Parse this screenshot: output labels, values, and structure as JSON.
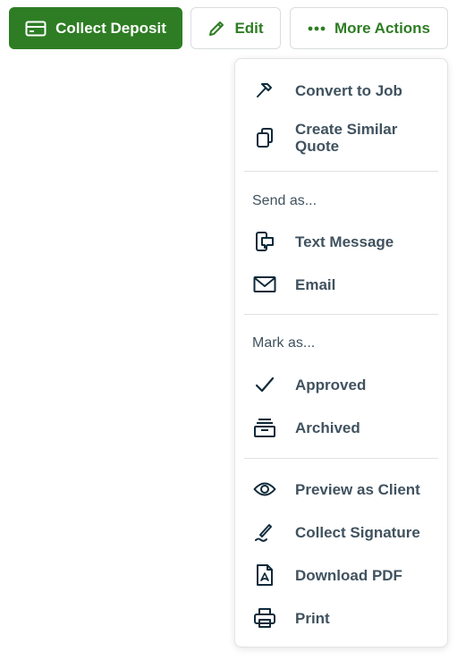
{
  "toolbar": {
    "collect_deposit_label": "Collect Deposit",
    "edit_label": "Edit",
    "more_actions_label": "More Actions"
  },
  "menu": {
    "convert_to_job": "Convert to Job",
    "create_similar_quote_line1": "Create Similar",
    "create_similar_quote_line2": "Quote",
    "send_as_label": "Send as...",
    "text_message": "Text Message",
    "email": "Email",
    "mark_as_label": "Mark as...",
    "approved": "Approved",
    "archived": "Archived",
    "preview_as_client": "Preview as Client",
    "collect_signature": "Collect Signature",
    "download_pdf": "Download PDF",
    "print": "Print"
  },
  "colors": {
    "brand_green": "#2e7d24",
    "menu_text": "#40525f",
    "icon": "#0f2a3a"
  }
}
